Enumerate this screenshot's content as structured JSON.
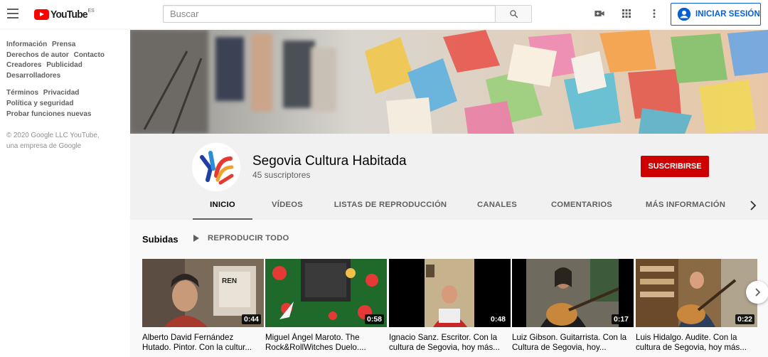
{
  "header": {
    "logo_text": "YouTube",
    "logo_country": "ES",
    "search_placeholder": "Buscar",
    "search_value": "",
    "signin_label": "INICIAR SESIÓN",
    "icons": [
      "menu-icon",
      "youtube-logo",
      "search-icon",
      "video-camera-icon",
      "apps-grid-icon",
      "more-vert-icon",
      "account-icon"
    ]
  },
  "sidebar": {
    "links_group1": [
      "Información",
      "Prensa",
      "Derechos de autor",
      "Contacto",
      "Creadores",
      "Publicidad",
      "Desarrolladores"
    ],
    "links_group2": [
      "Términos",
      "Privacidad",
      "Política y seguridad",
      "Probar funciones nuevas"
    ],
    "copyright_line1": "© 2020 Google LLC YouTube,",
    "copyright_line2": "una empresa de Google"
  },
  "channel": {
    "title": "Segovia Cultura Habitada",
    "subscribers": "45 suscriptores",
    "subscribe_label": "SUSCRIBIRSE",
    "tabs": [
      "INICIO",
      "VÍDEOS",
      "LISTAS DE REPRODUCCIÓN",
      "CANALES",
      "COMENTARIOS",
      "MÁS INFORMACIÓN"
    ],
    "active_tab": "INICIO"
  },
  "uploads": {
    "heading": "Subidas",
    "play_all_label": "REPRODUCIR TODO",
    "videos": [
      {
        "title": "Alberto David Fernández Hutado. Pintor. Con la cultur...",
        "duration": "0:44"
      },
      {
        "title": "Miguel Ángel Maroto. The Rock&RollWitches Duelo....",
        "duration": "0:58"
      },
      {
        "title": "Ignacio Sanz. Escritor. Con la cultura de Segovia, hoy más...",
        "duration": "0:48"
      },
      {
        "title": "Luiz Gibson. Guitarrista. Con la Cultura de Segovia, hoy...",
        "duration": "0:17"
      },
      {
        "title": "Luis Hidalgo. Audite. Con la cultura de Segovia, hoy más...",
        "duration": "0:22"
      }
    ]
  },
  "colors": {
    "brand_red": "#ff0000",
    "subscribe_red": "#cc0000",
    "link_blue": "#065fd4"
  }
}
